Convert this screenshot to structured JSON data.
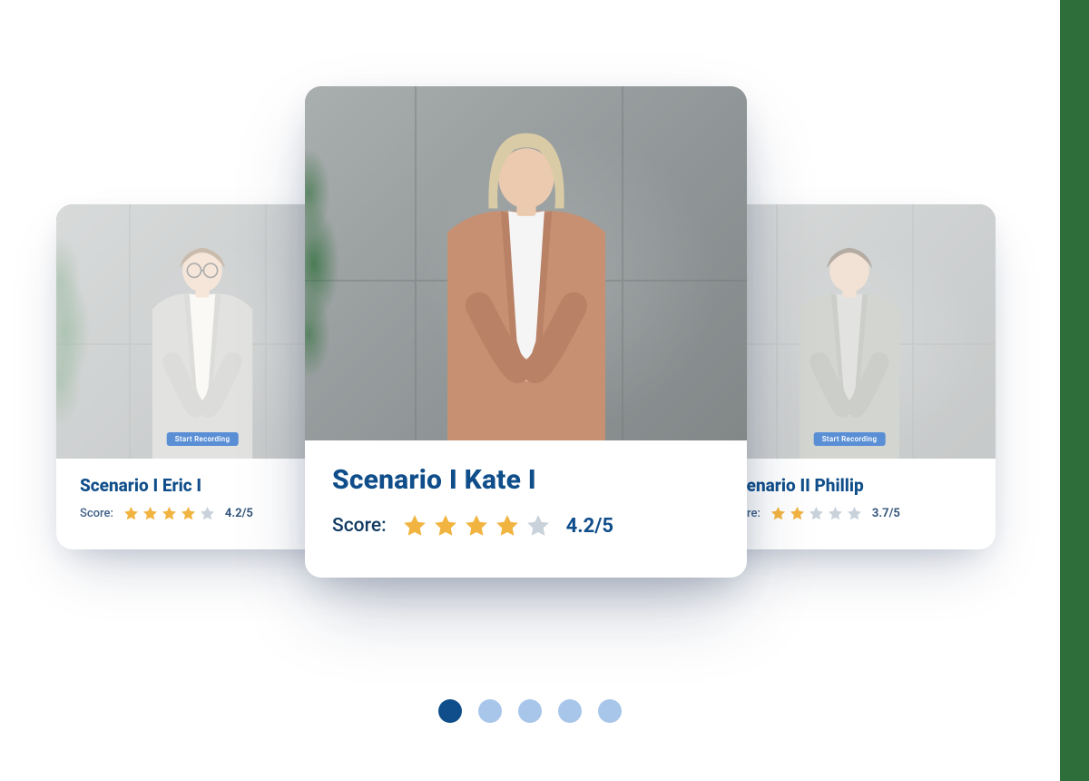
{
  "cards": [
    {
      "title": "Scenario I Eric I",
      "score_label": "Score:",
      "score_value": "4.2/5",
      "stars_filled": 4,
      "stars_total": 5,
      "record_chip": "Start Recording",
      "has_plant": true
    },
    {
      "title": "Scenario I Kate I",
      "score_label": "Score:",
      "score_value": "4.2/5",
      "stars_filled": 4,
      "stars_total": 5,
      "has_plant": true
    },
    {
      "title": "Scenario II Phillip",
      "score_label": "Score:",
      "score_value": "3.7/5",
      "stars_filled": 2,
      "stars_total": 5,
      "record_chip": "Start Recording",
      "has_plant": false
    }
  ],
  "pagination": {
    "total": 5,
    "active_index": 0
  },
  "colors": {
    "brand": "#0f4e8a",
    "star": "#f2b441",
    "side_bar": "#2e6e3a",
    "dot_inactive": "#a7c6ea"
  },
  "person_svgs": {
    "left": {
      "face": "#e8c7ac",
      "hair": "#8b6b4a",
      "hair_shape": "short",
      "jacket": "#bfc1bd",
      "jacket2": "#b1b3ae",
      "shirt": "#f4f1ea",
      "glasses": true
    },
    "center": {
      "face": "#eccab0",
      "hair": "#d9cba6",
      "hair_shape": "bob",
      "jacket": "#c79073",
      "jacket2": "#b98166",
      "shirt": "#f5f5f5",
      "glasses": false
    },
    "right": {
      "face": "#e3bfa3",
      "hair": "#5a4633",
      "hair_shape": "short",
      "jacket": "#9ea29a",
      "jacket2": "#8f938b",
      "shirt": "#bfc0bb",
      "glasses": false
    }
  }
}
